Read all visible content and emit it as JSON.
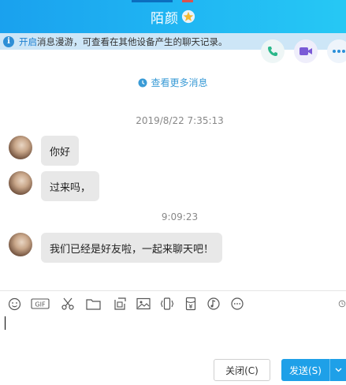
{
  "window": {
    "title": "陌颜",
    "accent": "#1aa1ee"
  },
  "notice": {
    "icon": "info-icon",
    "link": "开启",
    "text": "消息漫游，可查看在其他设备产生的聊天记录。"
  },
  "header_actions": [
    {
      "name": "voice-call-icon"
    },
    {
      "name": "video-call-icon"
    },
    {
      "name": "more-icon"
    }
  ],
  "chat": {
    "more_messages": "查看更多消息",
    "timestamp_1": "2019/8/22 7:35:13",
    "timestamp_2": "9:09:23",
    "messages": [
      {
        "text": "你好"
      },
      {
        "text": "过来吗，"
      },
      {
        "text": "我们已经是好友啦，一起来聊天吧！"
      }
    ]
  },
  "toolbar": {
    "tools": [
      "emoji-icon",
      "gif-icon",
      "screenshot-scissors-icon",
      "folder-icon",
      "image-editor-icon",
      "image-icon",
      "shake-icon",
      "red-packet-icon",
      "music-icon",
      "more-options-icon",
      "history-icon"
    ],
    "gif_label": "GIF"
  },
  "input": {
    "value": ""
  },
  "actions": {
    "close_label": "关闭(C)",
    "send_label": "发送(S)"
  }
}
